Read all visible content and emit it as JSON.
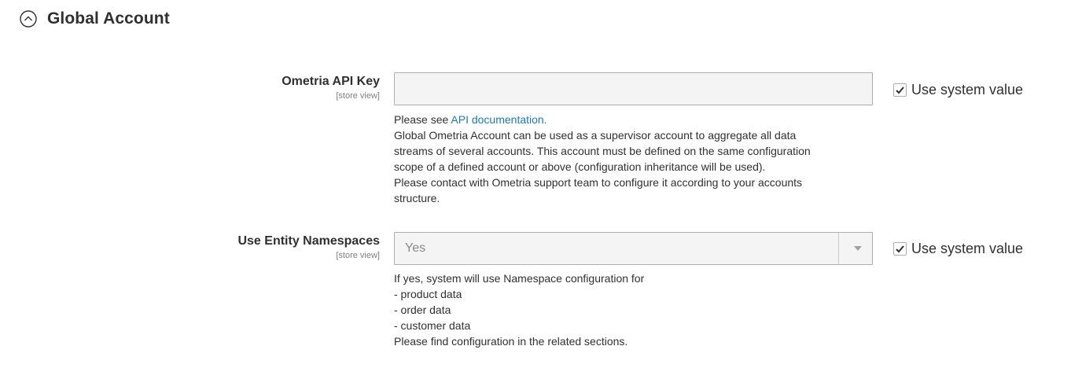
{
  "section": {
    "title": "Global Account",
    "icon": "collapse-up-circle-icon"
  },
  "api_key": {
    "label": "Ometria API Key",
    "scope": "[store view]",
    "value": "",
    "placeholder": "",
    "use_system_label": "Use system value",
    "use_system_checked": true,
    "note": {
      "prefix": "Please see ",
      "link_text": "API documentation.",
      "lines": [
        "Global Ometria Account can be used as a supervisor account to aggregate all data",
        "streams of several accounts. This account must be defined on the same configuration",
        "scope of a defined account or above (configuration inheritance will be used).",
        "Please contact with Ometria support team to configure it according to your accounts",
        "structure."
      ]
    }
  },
  "namespaces": {
    "label": "Use Entity Namespaces",
    "scope": "[store view]",
    "selected": "Yes",
    "use_system_label": "Use system value",
    "use_system_checked": true,
    "note_lines": [
      "If yes, system will use Namespace configuration for",
      "- product data",
      "- order data",
      "- customer data",
      "Please find configuration in the related sections."
    ]
  },
  "colors": {
    "link": "#1979c3",
    "text": "#303030",
    "disabled_bg": "#f4f4f4",
    "border": "#adadad"
  }
}
